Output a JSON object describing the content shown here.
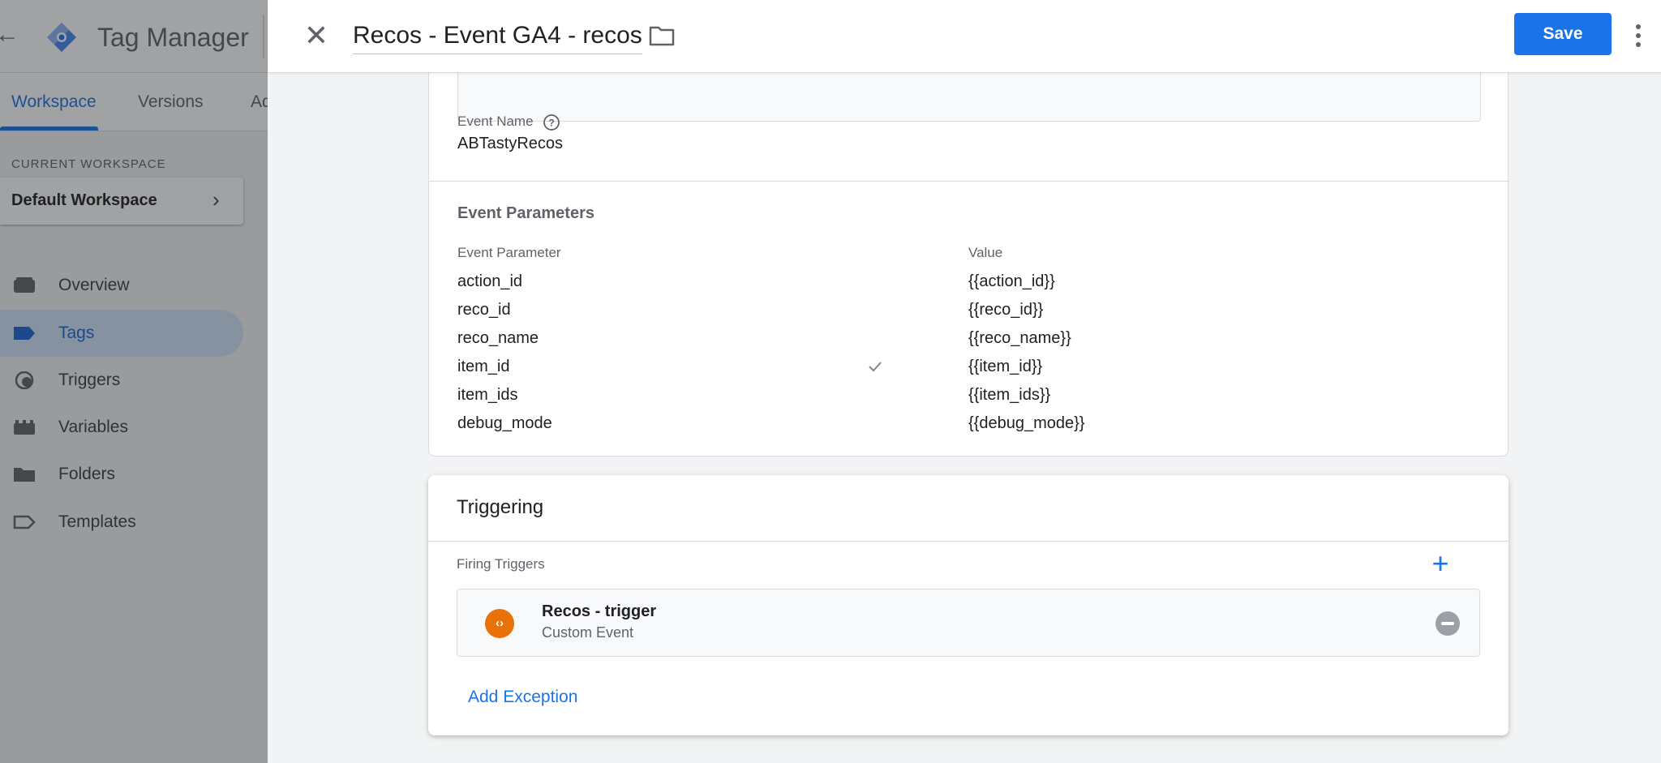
{
  "app": {
    "title": "Tag Manager",
    "tabs": [
      {
        "label": "Workspace"
      },
      {
        "label": "Versions"
      },
      {
        "label": "Ad"
      }
    ],
    "current_workspace_label": "CURRENT WORKSPACE",
    "workspace_name": "Default Workspace",
    "nav": [
      {
        "label": "Overview",
        "icon": "overview-icon"
      },
      {
        "label": "Tags",
        "icon": "tag-icon"
      },
      {
        "label": "Triggers",
        "icon": "trigger-icon"
      },
      {
        "label": "Variables",
        "icon": "variables-icon"
      },
      {
        "label": "Folders",
        "icon": "folder-icon"
      },
      {
        "label": "Templates",
        "icon": "template-icon"
      }
    ]
  },
  "panel": {
    "title": "Recos - Event GA4 - recos",
    "save_label": "Save",
    "event_name_label": "Event Name",
    "event_name_value": "ABTastyRecos",
    "event_params_title": "Event Parameters",
    "col_param": "Event Parameter",
    "col_value": "Value",
    "params": [
      {
        "name": "action_id",
        "value": "{{action_id}}"
      },
      {
        "name": "reco_id",
        "value": "{{reco_id}}"
      },
      {
        "name": "reco_name",
        "value": "{{reco_name}}"
      },
      {
        "name": "item_id",
        "value": "{{item_id}}"
      },
      {
        "name": "item_ids",
        "value": "{{item_ids}}"
      },
      {
        "name": "debug_mode",
        "value": "{{debug_mode}}"
      }
    ]
  },
  "triggering": {
    "title": "Triggering",
    "firing_label": "Firing Triggers",
    "trigger_name": "Recos - trigger",
    "trigger_type": "Custom Event",
    "badge": "‹›",
    "add_exception": "Add Exception"
  },
  "colors": {
    "accent": "#1a73e8",
    "trigger_badge": "#e8710a",
    "active_nav_bg": "#d2e3fc"
  }
}
